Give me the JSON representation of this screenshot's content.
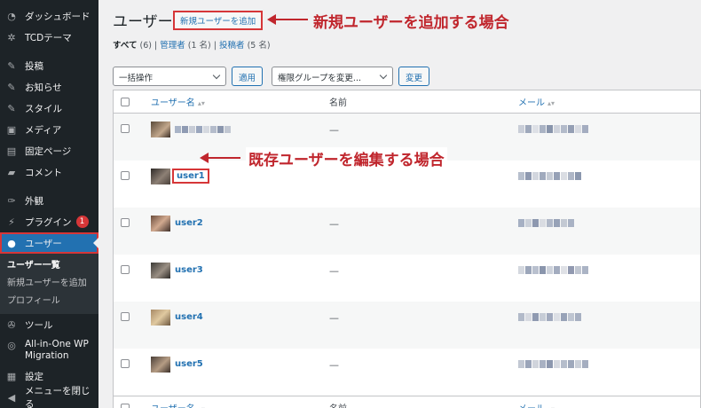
{
  "sidebar": {
    "items": [
      {
        "label": "ダッシュボード",
        "icon": "dashboard-icon"
      },
      {
        "label": "TCDテーマ",
        "icon": "gear-icon"
      },
      {
        "label": "投稿",
        "icon": "pin-icon"
      },
      {
        "label": "お知らせ",
        "icon": "pin-icon"
      },
      {
        "label": "スタイル",
        "icon": "pin-icon"
      },
      {
        "label": "メディア",
        "icon": "media-icon"
      },
      {
        "label": "固定ページ",
        "icon": "page-icon"
      },
      {
        "label": "コメント",
        "icon": "comment-icon"
      },
      {
        "label": "外観",
        "icon": "brush-icon"
      },
      {
        "label": "プラグイン",
        "icon": "plugin-icon",
        "badge": "1"
      },
      {
        "label": "ユーザー",
        "icon": "user-icon"
      }
    ],
    "submenu": [
      "ユーザー一覧",
      "新規ユーザーを追加",
      "プロフィール"
    ],
    "bottom": [
      {
        "label": "ツール",
        "icon": "wrench-icon"
      },
      {
        "label": "All-in-One WP Migration",
        "icon": "migration-icon"
      },
      {
        "label": "設定",
        "icon": "settings-icon"
      },
      {
        "label": "メニューを閉じる",
        "icon": "collapse-icon"
      }
    ]
  },
  "header": {
    "title": "ユーザー",
    "add_new": "新規ユーザーを追加",
    "annotation_add": "新規ユーザーを追加する場合",
    "annotation_edit": "既存ユーザーを編集する場合"
  },
  "filters": {
    "all": "すべて",
    "all_count": "(6)",
    "admin": "管理者",
    "admin_count": "(1 名)",
    "contributor": "投稿者",
    "contributor_count": "(5 名)",
    "sep": "|"
  },
  "controls": {
    "bulk_action": "一括操作",
    "apply": "適用",
    "role_change": "権限グループを変更...",
    "change": "変更"
  },
  "table": {
    "col_username": "ユーザー名",
    "col_name": "名前",
    "col_email": "メール",
    "rows": [
      {
        "username": "",
        "name": "—"
      },
      {
        "username": "user1",
        "name": ""
      },
      {
        "username": "user2",
        "name": "—"
      },
      {
        "username": "user3",
        "name": "—"
      },
      {
        "username": "user4",
        "name": "—"
      },
      {
        "username": "user5",
        "name": "—"
      }
    ]
  }
}
